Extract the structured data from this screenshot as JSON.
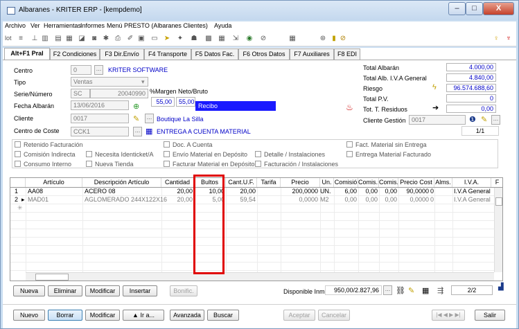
{
  "window": {
    "title": "Albaranes - KRITER ERP - [kempdemo]"
  },
  "window_buttons": {
    "minimize": "–",
    "maximize": "□",
    "close": "X"
  },
  "menu": [
    "Archivo",
    "Ver",
    "Herramientas",
    "Informes",
    "Menú PRESTO (Albaranes Clientes)",
    "Ayuda"
  ],
  "toolbar": {
    "lot_label": "lot",
    "icons": [
      "sort-icon",
      "stats-icon",
      "chart-icon",
      "filter-icon",
      "attach-icon",
      "print-preview-icon",
      "settings-icon",
      "printer-icon",
      "tools-icon",
      "send-icon",
      "window-icon",
      "arrow-icon",
      "pin-icon",
      "user-icon",
      "grid-icon",
      "table-icon",
      "export-icon",
      "eye-icon",
      "clear-icon",
      "calculator-icon",
      "link-icon",
      "info-icon",
      "paperclip-icon",
      "bulb-icon",
      "exit-icon"
    ]
  },
  "tabs": [
    "Alt+F1 Pral",
    "F2 Condiciones",
    "F3 Dir.Envío",
    "F4 Transporte",
    "F5 Datos Fac.",
    "F6 Otros Datos",
    "F7 Auxiliares",
    "F8 EDI"
  ],
  "form": {
    "centro_label": "Centro",
    "centro_value": "0",
    "centro_name": "KRITER SOFTWARE",
    "tipo_label": "Tipo",
    "tipo_value": "Ventas",
    "serie_label": "Serie/Número",
    "serie_value": "SC",
    "numero_value": "20040990",
    "fecha_label": "Fecha Albarán",
    "fecha_value": "13/06/2016",
    "margen_label": "%Margen Neto/Bruto",
    "margen_neto": "55,00",
    "margen_bruto": "55,00",
    "recibo": "Recibo",
    "cliente_label": "Cliente",
    "cliente_value": "0017",
    "cliente_name": "Boutique La Silla",
    "coste_label": "Centro de Coste",
    "coste_value": "CCK1",
    "coste_name": "ENTREGA A CUENTA MATERIAL"
  },
  "totals": {
    "total_albaran_label": "Total Albarán",
    "total_albaran": "4.000,00",
    "total_iva_label": "Total Alb. I.V.A General",
    "total_iva": "4.840,00",
    "riesgo_label": "Riesgo",
    "riesgo": "96.574.688,60",
    "total_pv_label": "Total P.V.",
    "total_pv": "0",
    "residuos_label": "Tot. T. Residuos",
    "residuos": "0,00",
    "gestion_label": "Cliente Gestión",
    "gestion_value": "0017",
    "page": "1/1"
  },
  "checks": {
    "retenido": "Retenido Facturación",
    "comision": "Comisión Indirecta",
    "consumo": "Consumo Interno",
    "necesita": "Necesita Identicket/A",
    "tienda": "Nueva Tienda",
    "doc": "Doc. A Cuenta",
    "envio": "Envío Material en Depósito",
    "facturar": "Facturar Material en Depósito",
    "detalle": "Detalle / Instalaciones",
    "facturacion": "Facturación / Instalaciones",
    "fact_sin": "Fact. Material sin Entrega",
    "entrega": "Entrega Material Facturado"
  },
  "grid": {
    "headers": [
      "Artículo",
      "Descripción Artículo",
      "Cantidad",
      "Bultos",
      "Cant.U.F.",
      "Tarifa",
      "Precio",
      "Un.",
      "Comisió",
      "Comis.:",
      "Comis.:",
      "Precio Cost",
      "Alms.",
      "I.V.A.",
      "F"
    ],
    "rows": [
      {
        "n": "1",
        "art": "AA08",
        "desc": "ACERO 08",
        "cant": "20,00",
        "bultos": "10,00",
        "cuf": "20,00",
        "tarifa": "",
        "precio": "200,0000",
        "un": "UN.",
        "c1": "6,00",
        "c2": "0,00",
        "c3": "0,00",
        "cost": "90,0000",
        "alms": "0",
        "iva": "I.V.A General"
      },
      {
        "n": "2",
        "art": "MAD01",
        "desc": "AGLOMERADO 244X122X16",
        "cant": "20,00",
        "bultos": "5,00",
        "cuf": "59,54",
        "tarifa": "",
        "precio": "0,0000",
        "un": "M2",
        "c1": "0,00",
        "c2": "0,00",
        "c3": "0,00",
        "cost": "0,0000",
        "alms": "0",
        "iva": "I.V.A General"
      }
    ]
  },
  "line_buttons": {
    "nueva": "Nueva",
    "eliminar": "Eliminar",
    "modificar": "Modificar",
    "insertar": "Insertar",
    "bonific": "Bonific.",
    "disponible_label": "Disponible Inm",
    "disponible_value": "950,00/2.827,96",
    "page": "2/2"
  },
  "bottom_buttons": {
    "nuevo": "Nuevo",
    "borrar": "Borrar",
    "modificar": "Modificar",
    "ira": "Ir a...",
    "avanzada": "Avanzada",
    "buscar": "Buscar",
    "aceptar": "Aceptar",
    "cancelar": "Cancelar",
    "salir": "Salir"
  },
  "colors": {
    "accent": "#0000c8",
    "recibo_bg": "#1a1aff",
    "highlight": "#e00000"
  }
}
